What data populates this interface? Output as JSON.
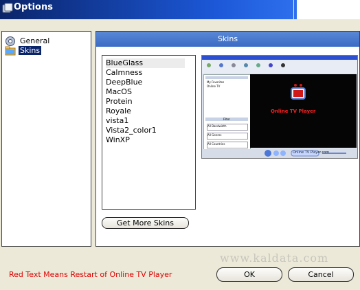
{
  "window": {
    "title": "Options",
    "title_icon": "options-app-icon"
  },
  "tree": {
    "items": [
      {
        "label": "General",
        "icon": "gear-icon",
        "selected": false
      },
      {
        "label": "Skins",
        "icon": "folder-icon",
        "selected": true
      }
    ]
  },
  "panel": {
    "header": "Skins",
    "skins": [
      "BlueGlass",
      "Calmness",
      "DeepBlue",
      "MacOS",
      "Protein",
      "Royale",
      "vista1",
      "Vista2_color1",
      "WinXP"
    ],
    "selected_skin": "BlueGlass",
    "get_more_label": "Get More Skins",
    "preview": {
      "app_name": "Online TV Player",
      "tree_items": [
        "My Favorites",
        "Online TV"
      ],
      "filters": [
        "All Bandwidth",
        "All Genres",
        "All Countries"
      ],
      "filter_title": "Filter",
      "bottom_label": "Online TV Player.com"
    }
  },
  "footer": {
    "note": "Red Text Means Restart of Online TV Player",
    "ok_label": "OK",
    "cancel_label": "Cancel",
    "watermark": "www.kaldata.com"
  },
  "colors": {
    "title_gradient_start": "#0a246a",
    "title_gradient_end": "#3c82ff",
    "panel_header": "#4a7bd0",
    "warning_red": "#e00000",
    "dialog_bg": "#ece9d8"
  }
}
